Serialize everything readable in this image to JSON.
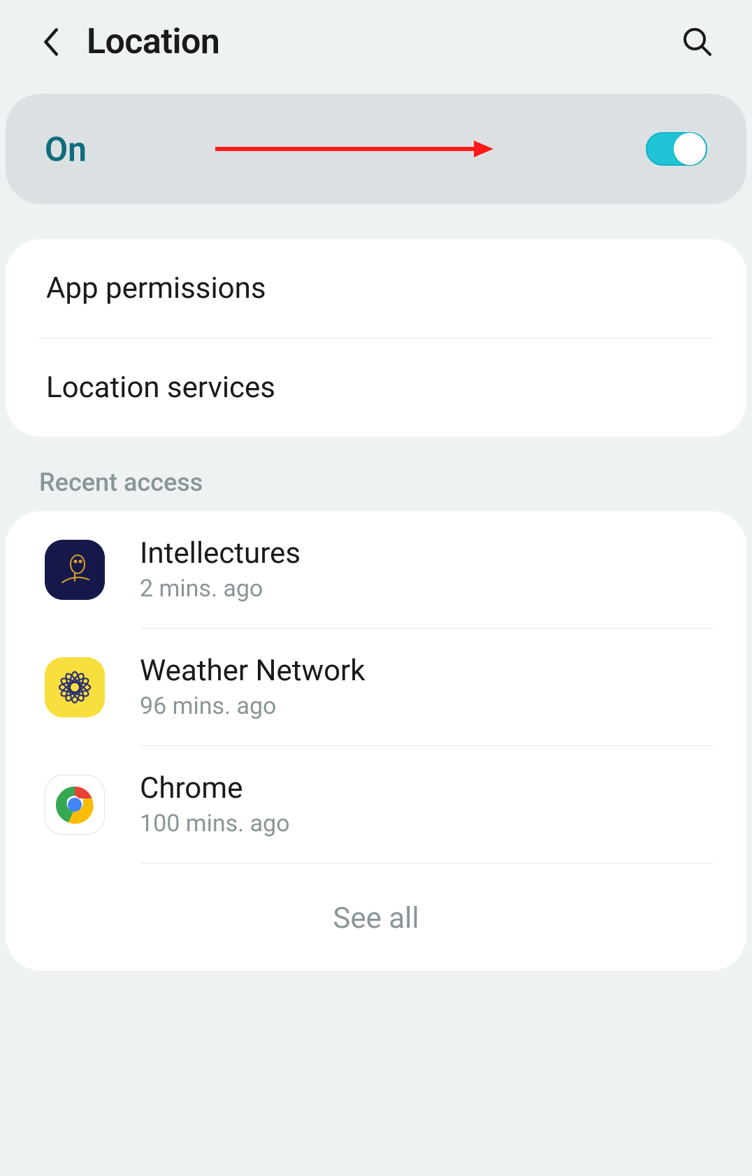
{
  "header": {
    "title": "Location"
  },
  "toggle": {
    "label": "On",
    "enabled": true
  },
  "options": [
    {
      "label": "App permissions"
    },
    {
      "label": "Location services"
    }
  ],
  "recent": {
    "section_label": "Recent access",
    "items": [
      {
        "name": "Intellectures",
        "time": "2 mins. ago",
        "icon": "intellectures-icon"
      },
      {
        "name": "Weather Network",
        "time": "96 mins. ago",
        "icon": "weather-network-icon"
      },
      {
        "name": "Chrome",
        "time": "100 mins. ago",
        "icon": "chrome-icon"
      }
    ],
    "see_all_label": "See all"
  },
  "annotation": {
    "type": "arrow",
    "color": "#ff0000"
  }
}
